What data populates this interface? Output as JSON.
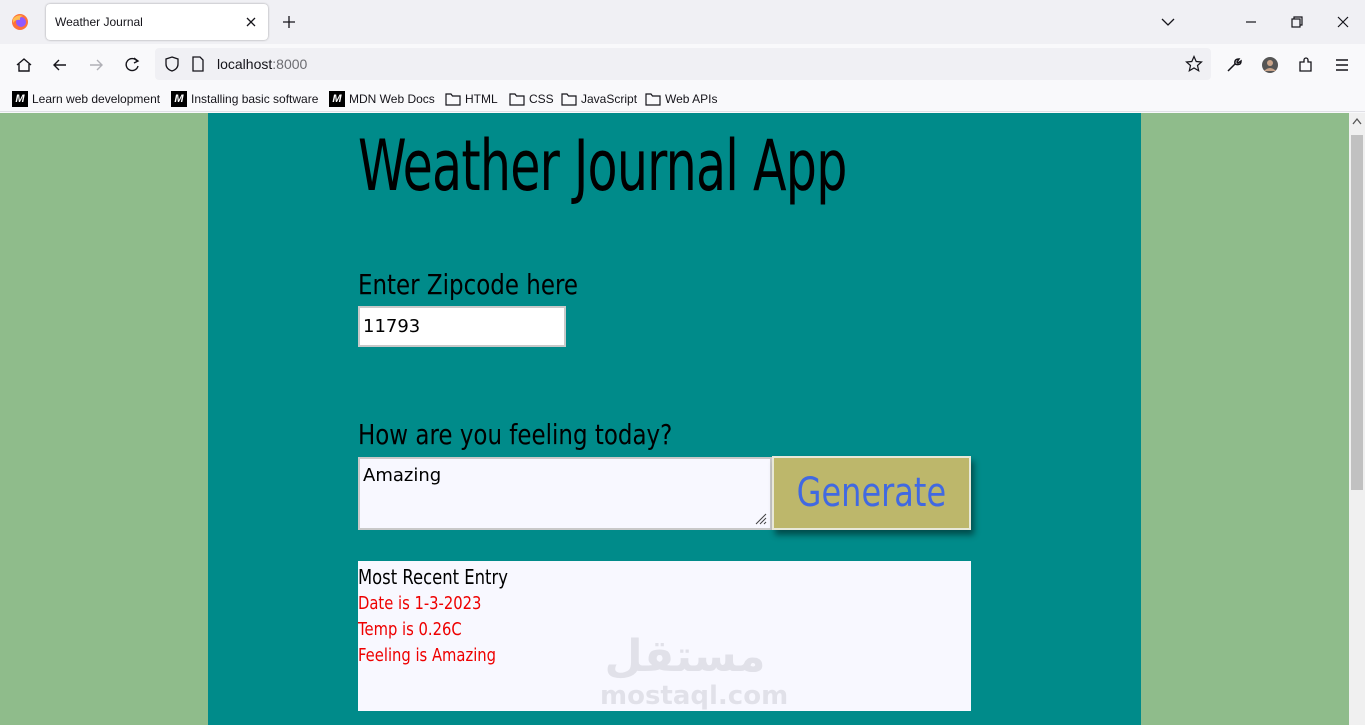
{
  "browser": {
    "tab_title": "Weather Journal",
    "url_host": "localhost",
    "url_port": ":8000",
    "bookmarks": [
      {
        "label": "Learn web development",
        "icon": "mdn-icon"
      },
      {
        "label": "Installing basic software",
        "icon": "mdn-icon"
      },
      {
        "label": "MDN Web Docs",
        "icon": "mdn-icon"
      },
      {
        "label": "HTML",
        "icon": "folder-icon"
      },
      {
        "label": "CSS",
        "icon": "folder-icon"
      },
      {
        "label": "JavaScript",
        "icon": "folder-icon"
      },
      {
        "label": "Web APIs",
        "icon": "folder-icon"
      }
    ]
  },
  "app": {
    "title": "Weather Journal App",
    "zip_label": "Enter Zipcode here",
    "zip_value": "11793",
    "feelings_label": "How are you feeling today?",
    "feelings_value": "Amazing",
    "generate_label": "Generate",
    "entry": {
      "heading": "Most Recent Entry",
      "date": "Date is 1-3-2023",
      "temp": "Temp is 0.26C",
      "content": "Feeling is Amazing"
    },
    "watermark": {
      "arabic": "مستقل",
      "latin": "mostaql.com"
    }
  },
  "colors": {
    "page_bg": "#8fbc8b",
    "main_bg": "#008b8a",
    "button_bg": "#bdb76b",
    "button_text": "#4169e1",
    "entry_text": "#ee0000"
  }
}
